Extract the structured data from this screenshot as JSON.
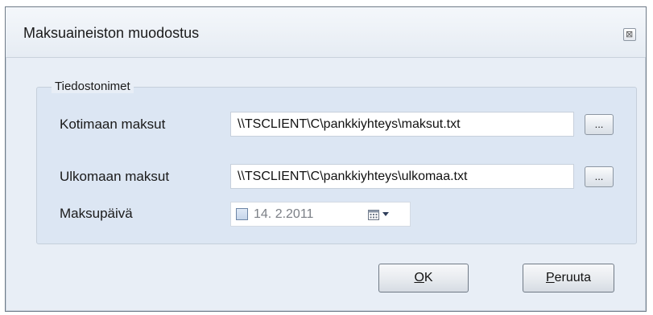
{
  "window": {
    "title": "Maksuaineiston muodostus",
    "close_glyph": "⊠"
  },
  "group": {
    "legend": "Tiedostonimet",
    "rows": [
      {
        "label": "Kotimaan maksut",
        "value": "\\\\TSCLIENT\\C\\pankkiyhteys\\maksut.txt",
        "browse_label": "..."
      },
      {
        "label": "Ulkomaan maksut",
        "value": "\\\\TSCLIENT\\C\\pankkiyhteys\\ulkomaa.txt",
        "browse_label": "..."
      }
    ],
    "date": {
      "label": "Maksupäivä",
      "value": "14. 2.2011",
      "checked": false
    }
  },
  "buttons": {
    "ok": {
      "mnemonic": "O",
      "rest": "K"
    },
    "cancel": {
      "mnemonic": "P",
      "rest": "eruuta"
    }
  },
  "colors": {
    "window_bg": "#e9eef5",
    "group_bg": "#dce6f3"
  },
  "icons": [
    "close-icon",
    "calendar-icon",
    "dropdown-arrow-icon"
  ]
}
